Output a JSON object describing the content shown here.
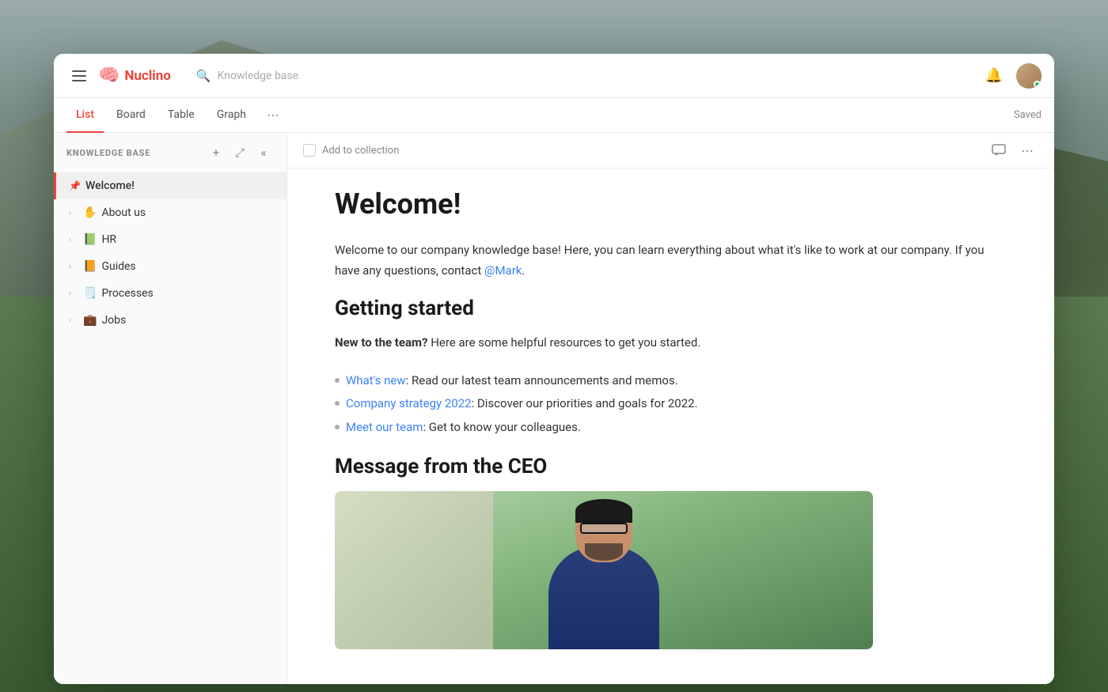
{
  "app": {
    "title": "Nuclino"
  },
  "header": {
    "menu_label": "Menu",
    "logo": "Nuclino",
    "search_placeholder": "Knowledge base",
    "bell_label": "Notifications",
    "avatar_label": "User avatar"
  },
  "tabs": {
    "items": [
      {
        "id": "list",
        "label": "List",
        "active": true
      },
      {
        "id": "board",
        "label": "Board",
        "active": false
      },
      {
        "id": "table",
        "label": "Table",
        "active": false
      },
      {
        "id": "graph",
        "label": "Graph",
        "active": false
      }
    ],
    "more_label": "⋯",
    "saved_label": "Saved"
  },
  "sidebar": {
    "title": "KNOWLEDGE BASE",
    "add_label": "+",
    "expand_label": "⤢",
    "collapse_label": "«",
    "items": [
      {
        "id": "welcome",
        "label": "Welcome!",
        "emoji": "📌",
        "active": true,
        "pinned": true
      },
      {
        "id": "about-us",
        "label": "About us",
        "emoji": "✋",
        "active": false
      },
      {
        "id": "hr",
        "label": "HR",
        "emoji": "📗",
        "active": false
      },
      {
        "id": "guides",
        "label": "Guides",
        "emoji": "📙",
        "active": false
      },
      {
        "id": "processes",
        "label": "Processes",
        "emoji": "🗒️",
        "active": false
      },
      {
        "id": "jobs",
        "label": "Jobs",
        "emoji": "💼",
        "active": false
      }
    ]
  },
  "content": {
    "add_to_collection": "Add to collection",
    "page_title": "Welcome!",
    "intro_text": "Welcome to our company knowledge base! Here, you can learn everything about what it's like to work at our company. If you have any questions, contact",
    "contact_link": "@Mark",
    "intro_end": ".",
    "getting_started_title": "Getting started",
    "new_to_team_label": "New to the team?",
    "new_to_team_text": " Here are some helpful resources to get you started.",
    "bullet_items": [
      {
        "link_text": "What's new",
        "rest": ": Read our latest team announcements and memos."
      },
      {
        "link_text": "Company strategy 2022",
        "rest": ": Discover our priorities and goals for 2022."
      },
      {
        "link_text": "Meet our team",
        "rest": ": Get to know your colleagues."
      }
    ],
    "ceo_message_title": "Message from the CEO",
    "video_alt": "CEO video message"
  }
}
